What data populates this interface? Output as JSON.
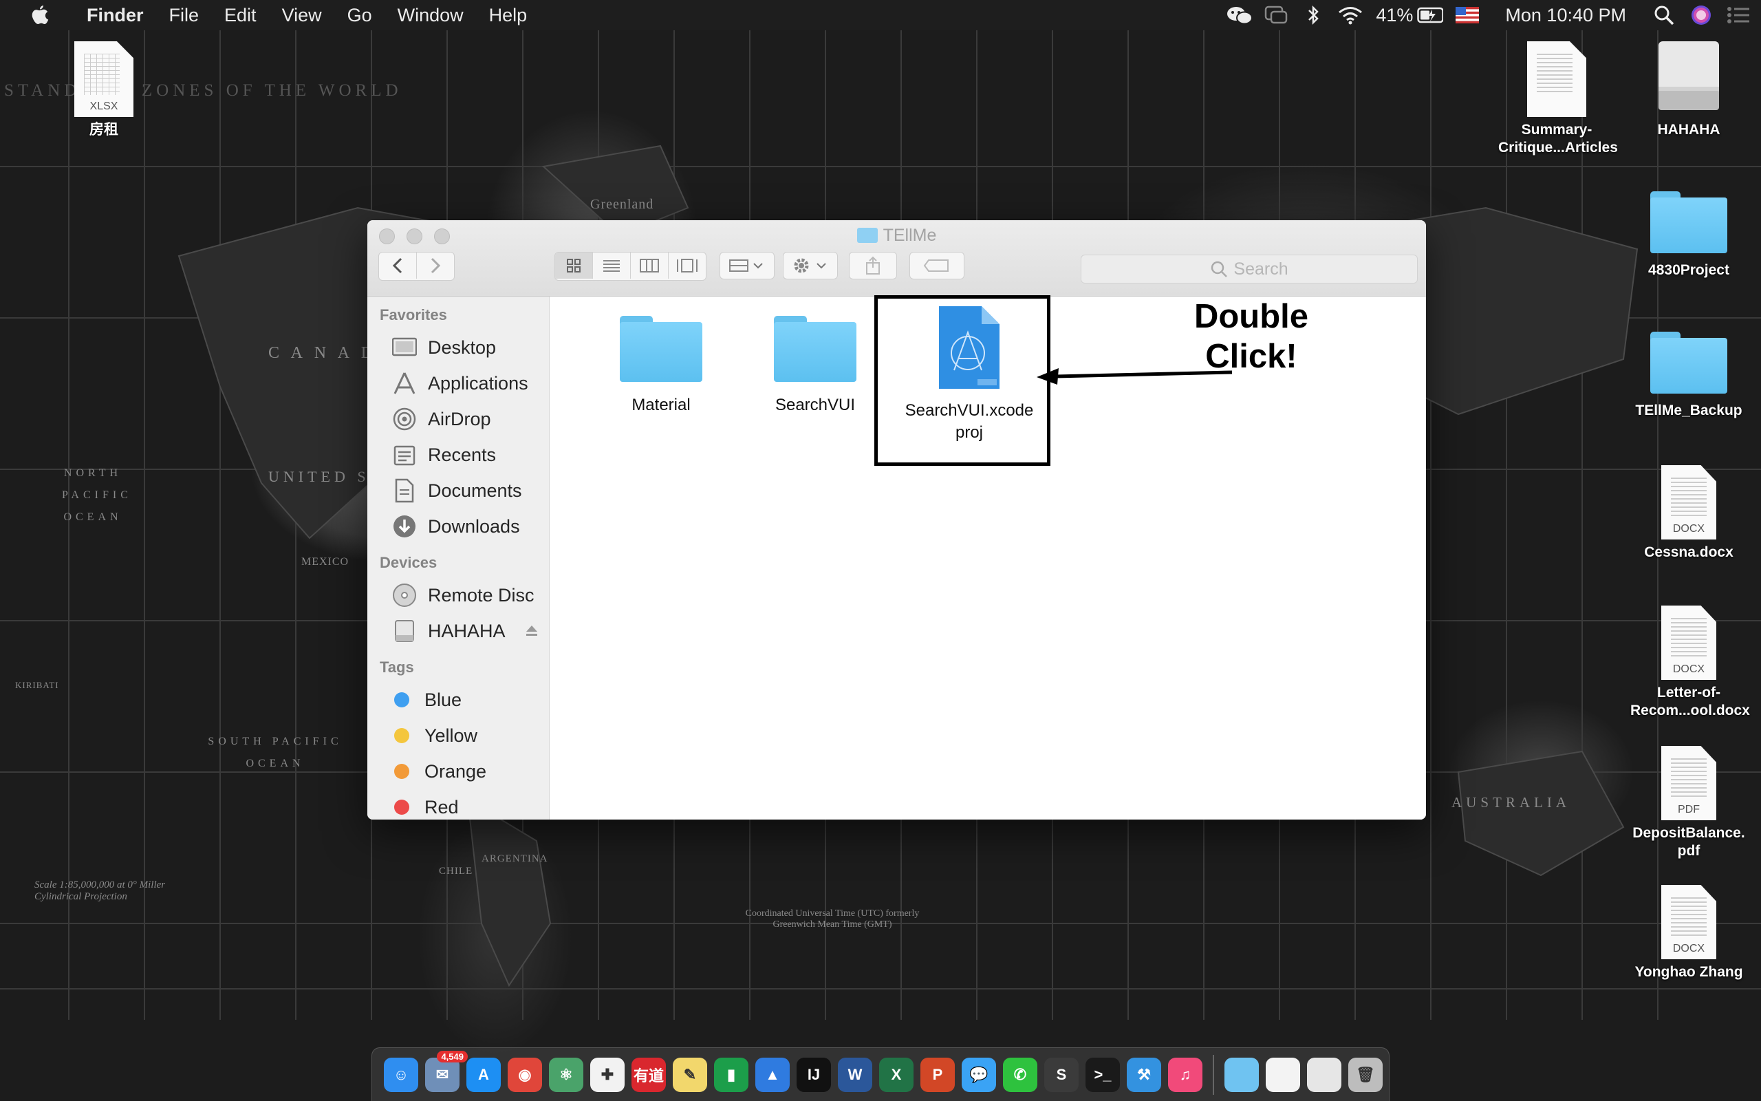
{
  "menubar": {
    "app_name": "Finder",
    "menus": [
      "File",
      "Edit",
      "View",
      "Go",
      "Window",
      "Help"
    ],
    "battery": "41%",
    "clock": "Mon 10:40 PM",
    "status_icons": [
      "wechat-icon",
      "chat-icon",
      "bluetooth-icon",
      "wifi-icon",
      "battery-icon",
      "us-flag-icon",
      "spotlight-icon",
      "siri-icon",
      "notification-center-icon"
    ]
  },
  "wallpaper": {
    "title": "STANDA…E ZONES OF THE WORLD",
    "labels": [
      "Greenland",
      "C A N A D",
      "UNITED ST",
      "MEXICO",
      "NORTH PACIFIC OCEAN",
      "SOUTH PACIFIC OCEAN",
      "ARGENTINA",
      "CHILE",
      "AUSTRALIA",
      "KIRIBATI"
    ],
    "scale_note": "Scale 1:85,000,000 at 0° Miller Cylindrical Projection",
    "utc_note": "Coordinated Universal Time (UTC) formerly Greenwich Mean Time (GMT)"
  },
  "desktop": {
    "left_icons": [
      {
        "name": "房租",
        "ext": "XLSX"
      }
    ],
    "right_icons": [
      {
        "name": "Summary-\nCritique...Articles",
        "type": "doc"
      },
      {
        "name": "HAHAHA",
        "type": "drive"
      },
      {
        "name": "4830Project",
        "type": "folder"
      },
      {
        "name": "TEllMe_Backup",
        "type": "folder"
      },
      {
        "name": "Cessna.docx",
        "type": "doc",
        "ext": "DOCX"
      },
      {
        "name": "Letter-of-\nRecom...ool.docx",
        "type": "doc",
        "ext": "DOCX"
      },
      {
        "name": "DepositBalance.\npdf",
        "type": "doc",
        "ext": "PDF"
      },
      {
        "name": "Yonghao Zhang",
        "type": "doc",
        "ext": "DOCX"
      }
    ]
  },
  "finder": {
    "title": "TEllMe",
    "search_placeholder": "Search",
    "sidebar": {
      "favorites_header": "Favorites",
      "favorites": [
        "Desktop",
        "Applications",
        "AirDrop",
        "Recents",
        "Documents",
        "Downloads"
      ],
      "devices_header": "Devices",
      "devices": [
        "Remote Disc",
        "HAHAHA"
      ],
      "tags_header": "Tags",
      "tags": [
        {
          "label": "Blue",
          "color": "#3f9ff0"
        },
        {
          "label": "Yellow",
          "color": "#f4c63d"
        },
        {
          "label": "Orange",
          "color": "#f29a38"
        },
        {
          "label": "Red",
          "color": "#ec4a49"
        }
      ]
    },
    "items": [
      {
        "name": "Material",
        "type": "folder"
      },
      {
        "name": "SearchVUI",
        "type": "folder"
      },
      {
        "name": "SearchVUI.xcode\nproj",
        "type": "xcodeproj"
      }
    ],
    "annotation": "Double\nClick!"
  },
  "dock": {
    "mail_badge": "4,549",
    "apps": [
      {
        "name": "finder-icon",
        "color": "#2f8ef0",
        "glyph": "☺"
      },
      {
        "name": "photo-app-icon",
        "color": "#6f8fb8",
        "glyph": "✉"
      },
      {
        "name": "app-store-icon",
        "color": "#1d8ff3",
        "glyph": "A"
      },
      {
        "name": "chrome-icon",
        "color": "#e0463a",
        "glyph": "◉"
      },
      {
        "name": "atom-icon",
        "color": "#4aa36a",
        "glyph": "⚛"
      },
      {
        "name": "tableau-icon",
        "color": "#f2f2f2",
        "glyph": "✚"
      },
      {
        "name": "youdao-icon",
        "color": "#d9272e",
        "glyph": "有道"
      },
      {
        "name": "notes-icon",
        "color": "#f2d76c",
        "glyph": "✎"
      },
      {
        "name": "numbers-icon",
        "color": "#1c9e4a",
        "glyph": "▮"
      },
      {
        "name": "keynote-icon",
        "color": "#2f7be0",
        "glyph": "▲"
      },
      {
        "name": "intellij-icon",
        "color": "#111111",
        "glyph": "IJ"
      },
      {
        "name": "word-icon",
        "color": "#2b579a",
        "glyph": "W"
      },
      {
        "name": "excel-icon",
        "color": "#217346",
        "glyph": "X"
      },
      {
        "name": "powerpoint-icon",
        "color": "#d24726",
        "glyph": "P"
      },
      {
        "name": "messages-icon",
        "color": "#3aa3f5",
        "glyph": "💬"
      },
      {
        "name": "wechat-icon",
        "color": "#2ec23e",
        "glyph": "✆"
      },
      {
        "name": "sublime-icon",
        "color": "#3b3b3b",
        "glyph": "S"
      },
      {
        "name": "terminal-icon",
        "color": "#1a1a1a",
        "glyph": ">_"
      },
      {
        "name": "xcode-icon",
        "color": "#3392e0",
        "glyph": "⚒"
      },
      {
        "name": "itunes-icon",
        "color": "#f14a7a",
        "glyph": "♫"
      }
    ],
    "right_items": [
      {
        "name": "downloads-stack-icon",
        "color": "#6fc3f1",
        "glyph": ""
      },
      {
        "name": "document-stack-icon",
        "color": "#f3f3f3",
        "glyph": ""
      },
      {
        "name": "screenshot-stack-icon",
        "color": "#e6e6e6",
        "glyph": ""
      },
      {
        "name": "trash-icon",
        "color": "#bdbdbd",
        "glyph": "🗑"
      }
    ]
  }
}
